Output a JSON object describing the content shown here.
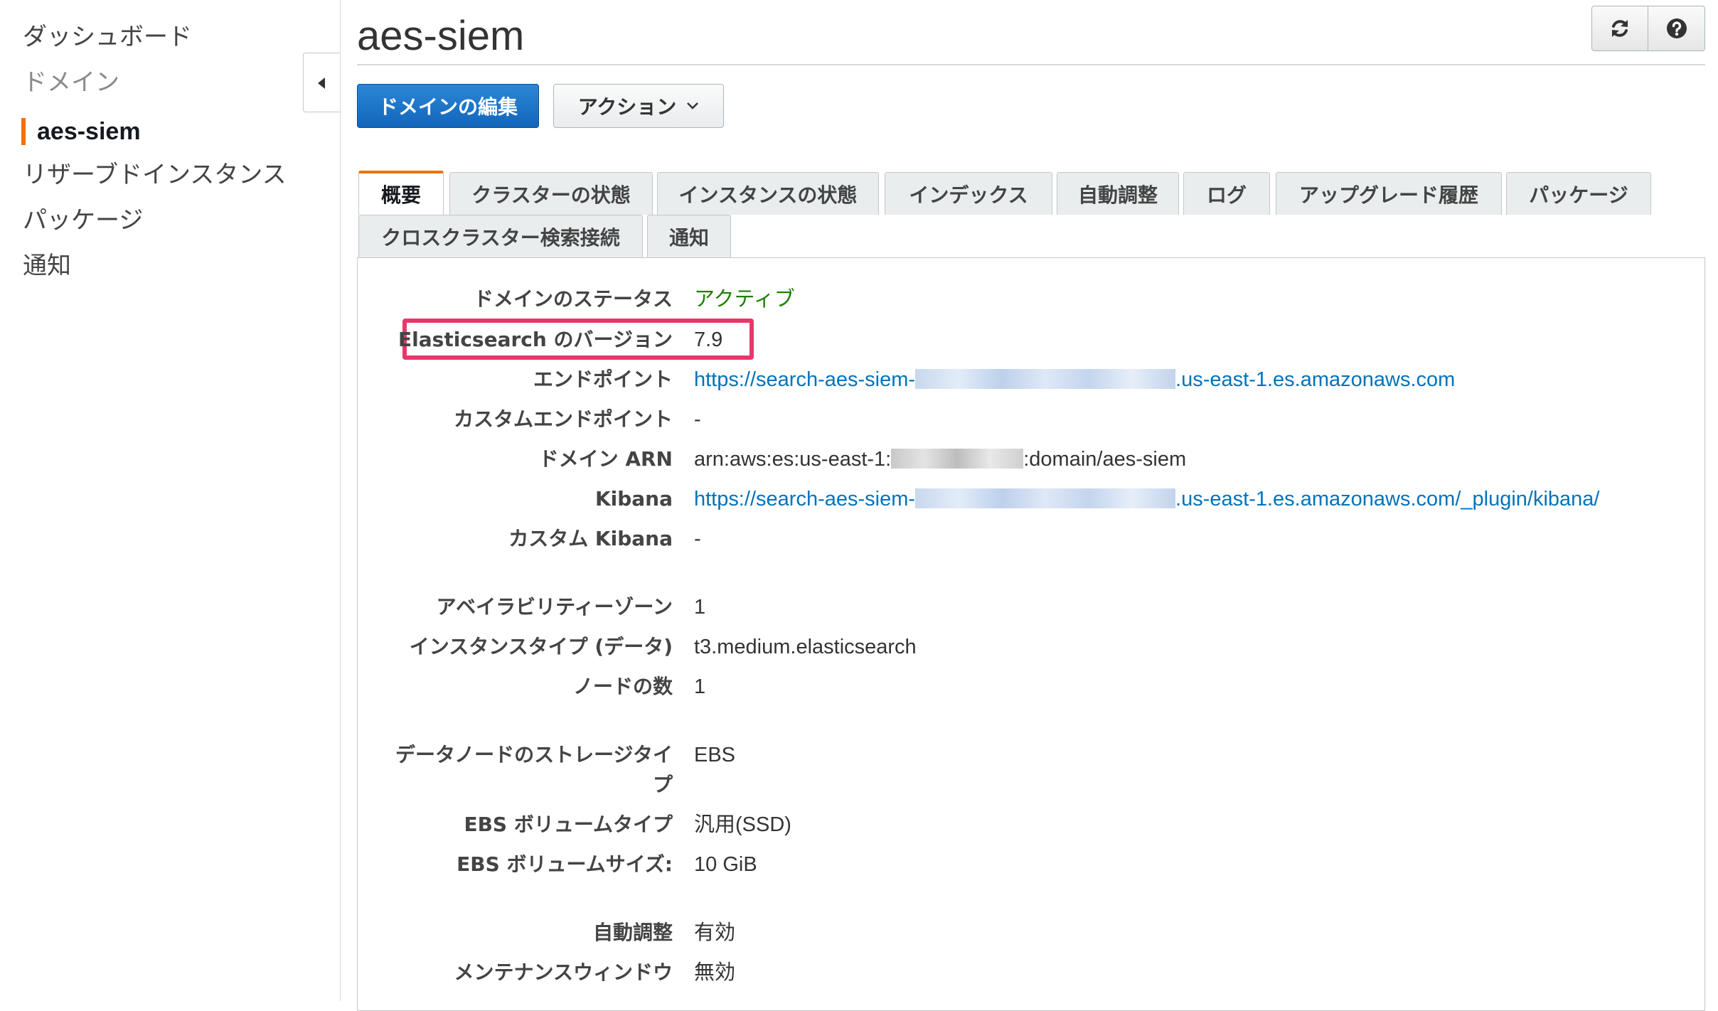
{
  "sidebar": {
    "items": [
      {
        "label": "ダッシュボード"
      },
      {
        "label": "ドメイン"
      },
      {
        "label": "aes-siem"
      },
      {
        "label": "リザーブドインスタンス"
      },
      {
        "label": "パッケージ"
      },
      {
        "label": "通知"
      }
    ]
  },
  "header": {
    "title": "aes-siem",
    "refresh_icon": "refresh-icon",
    "help_icon": "help-icon"
  },
  "toolbar": {
    "edit_label": "ドメインの編集",
    "actions_label": "アクション"
  },
  "tabs": [
    {
      "label": "概要"
    },
    {
      "label": "クラスターの状態"
    },
    {
      "label": "インスタンスの状態"
    },
    {
      "label": "インデックス"
    },
    {
      "label": "自動調整"
    },
    {
      "label": "ログ"
    },
    {
      "label": "アップグレード履歴"
    },
    {
      "label": "パッケージ"
    },
    {
      "label": "クロスクラスター検索接続"
    },
    {
      "label": "通知"
    }
  ],
  "overview": {
    "status": {
      "label": "ドメインのステータス",
      "value": "アクティブ"
    },
    "version": {
      "label": "Elasticsearch のバージョン",
      "value": "7.9"
    },
    "endpoint": {
      "label": "エンドポイント",
      "prefix": "https://search-aes-siem-",
      "suffix": ".us-east-1.es.amazonaws.com"
    },
    "custom_endpoint": {
      "label": "カスタムエンドポイント",
      "value": "-"
    },
    "arn": {
      "label": "ドメイン ARN",
      "prefix": "arn:aws:es:us-east-1:",
      "suffix": ":domain/aes-siem"
    },
    "kibana": {
      "label": "Kibana",
      "prefix": "https://search-aes-siem-",
      "suffix": ".us-east-1.es.amazonaws.com/_plugin/kibana/"
    },
    "custom_kibana": {
      "label": "カスタム Kibana",
      "value": "-"
    },
    "az": {
      "label": "アベイラビリティーゾーン",
      "value": "1"
    },
    "instance_type": {
      "label": "インスタンスタイプ (データ)",
      "value": "t3.medium.elasticsearch"
    },
    "node_count": {
      "label": "ノードの数",
      "value": "1"
    },
    "storage_type": {
      "label_line1": "データノードのストレージタイ",
      "label_line2": "プ",
      "value": "EBS"
    },
    "ebs_volume_type": {
      "label": "EBS ボリュームタイプ",
      "value": "汎用(SSD)"
    },
    "ebs_volume_size": {
      "label": "EBS ボリュームサイズ:",
      "value": "10 GiB"
    },
    "auto_tune": {
      "label": "自動調整",
      "value": "有効"
    },
    "maintenance_window": {
      "label": "メンテナンスウィンドウ",
      "value": "無効"
    }
  },
  "colors": {
    "accent": "#ec7211",
    "primary": "#1166bb",
    "status_active": "#1d8102",
    "link": "#0073bb",
    "highlight": "#e8386a"
  }
}
